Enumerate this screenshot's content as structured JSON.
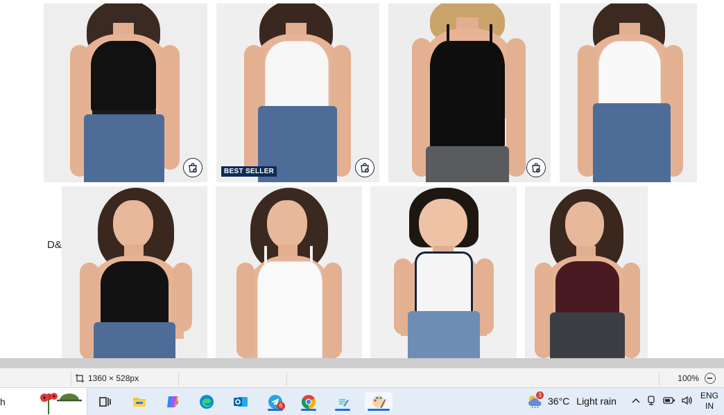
{
  "canvas": {
    "side_label": "D&C",
    "badge": "BEST SELLER",
    "products_row1": [
      {
        "top_color": "#111111",
        "pants": "jeans",
        "belt": true,
        "bag": true
      },
      {
        "top_color": "#f7f7f7",
        "pants": "jeans",
        "belt": false,
        "bag": true
      },
      {
        "top_color": "#0e0e0e",
        "pants": "grey",
        "belt": false,
        "bag": true
      },
      {
        "top_color": "#f9f9f9",
        "pants": "jeans",
        "belt": false,
        "bag": false
      }
    ],
    "products_row2": [
      {
        "top_color": "#121212",
        "pants": "jeans"
      },
      {
        "top_color": "#fafafa",
        "pants": "none"
      },
      {
        "top_color": "#f5f5f5",
        "pants": "jeans"
      },
      {
        "top_color": "#4a1a22",
        "pants": "dark"
      }
    ]
  },
  "statusbar": {
    "dimensions": "1360 × 528px",
    "zoom": "100%"
  },
  "taskbar": {
    "search_fragment": "h",
    "telegram_count": "6",
    "weather_badge": "3",
    "temperature": "36°C",
    "condition": "Light rain",
    "lang_line1": "ENG",
    "lang_line2": "IN"
  },
  "colors": {
    "taskbar_bg": "#e4ecf7",
    "statusbar_bg": "#f3f3f3",
    "badge_bg": "#0f2b55",
    "accent": "#1f6fd1"
  }
}
